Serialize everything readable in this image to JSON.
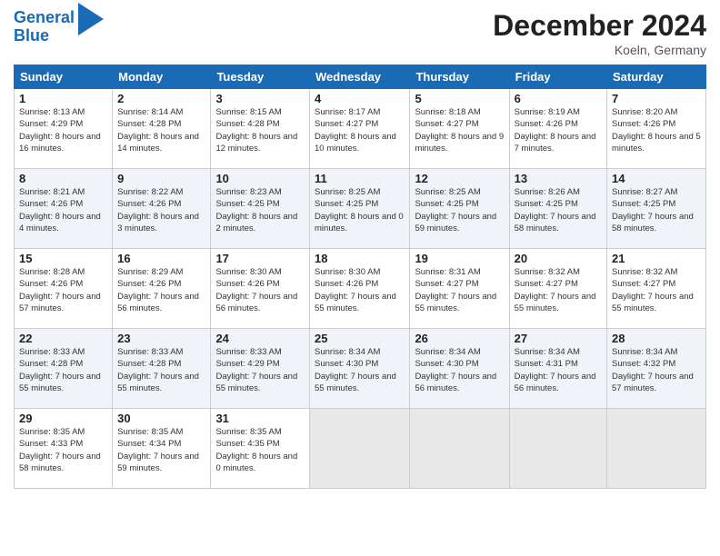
{
  "header": {
    "logo_line1": "General",
    "logo_line2": "Blue",
    "month_title": "December 2024",
    "location": "Koeln, Germany"
  },
  "weekdays": [
    "Sunday",
    "Monday",
    "Tuesday",
    "Wednesday",
    "Thursday",
    "Friday",
    "Saturday"
  ],
  "weeks": [
    [
      {
        "day": "1",
        "sunrise": "8:13 AM",
        "sunset": "4:29 PM",
        "daylight": "8 hours and 16 minutes."
      },
      {
        "day": "2",
        "sunrise": "8:14 AM",
        "sunset": "4:28 PM",
        "daylight": "8 hours and 14 minutes."
      },
      {
        "day": "3",
        "sunrise": "8:15 AM",
        "sunset": "4:28 PM",
        "daylight": "8 hours and 12 minutes."
      },
      {
        "day": "4",
        "sunrise": "8:17 AM",
        "sunset": "4:27 PM",
        "daylight": "8 hours and 10 minutes."
      },
      {
        "day": "5",
        "sunrise": "8:18 AM",
        "sunset": "4:27 PM",
        "daylight": "8 hours and 9 minutes."
      },
      {
        "day": "6",
        "sunrise": "8:19 AM",
        "sunset": "4:26 PM",
        "daylight": "8 hours and 7 minutes."
      },
      {
        "day": "7",
        "sunrise": "8:20 AM",
        "sunset": "4:26 PM",
        "daylight": "8 hours and 5 minutes."
      }
    ],
    [
      {
        "day": "8",
        "sunrise": "8:21 AM",
        "sunset": "4:26 PM",
        "daylight": "8 hours and 4 minutes."
      },
      {
        "day": "9",
        "sunrise": "8:22 AM",
        "sunset": "4:26 PM",
        "daylight": "8 hours and 3 minutes."
      },
      {
        "day": "10",
        "sunrise": "8:23 AM",
        "sunset": "4:25 PM",
        "daylight": "8 hours and 2 minutes."
      },
      {
        "day": "11",
        "sunrise": "8:25 AM",
        "sunset": "4:25 PM",
        "daylight": "8 hours and 0 minutes."
      },
      {
        "day": "12",
        "sunrise": "8:25 AM",
        "sunset": "4:25 PM",
        "daylight": "7 hours and 59 minutes."
      },
      {
        "day": "13",
        "sunrise": "8:26 AM",
        "sunset": "4:25 PM",
        "daylight": "7 hours and 58 minutes."
      },
      {
        "day": "14",
        "sunrise": "8:27 AM",
        "sunset": "4:25 PM",
        "daylight": "7 hours and 58 minutes."
      }
    ],
    [
      {
        "day": "15",
        "sunrise": "8:28 AM",
        "sunset": "4:26 PM",
        "daylight": "7 hours and 57 minutes."
      },
      {
        "day": "16",
        "sunrise": "8:29 AM",
        "sunset": "4:26 PM",
        "daylight": "7 hours and 56 minutes."
      },
      {
        "day": "17",
        "sunrise": "8:30 AM",
        "sunset": "4:26 PM",
        "daylight": "7 hours and 56 minutes."
      },
      {
        "day": "18",
        "sunrise": "8:30 AM",
        "sunset": "4:26 PM",
        "daylight": "7 hours and 55 minutes."
      },
      {
        "day": "19",
        "sunrise": "8:31 AM",
        "sunset": "4:27 PM",
        "daylight": "7 hours and 55 minutes."
      },
      {
        "day": "20",
        "sunrise": "8:32 AM",
        "sunset": "4:27 PM",
        "daylight": "7 hours and 55 minutes."
      },
      {
        "day": "21",
        "sunrise": "8:32 AM",
        "sunset": "4:27 PM",
        "daylight": "7 hours and 55 minutes."
      }
    ],
    [
      {
        "day": "22",
        "sunrise": "8:33 AM",
        "sunset": "4:28 PM",
        "daylight": "7 hours and 55 minutes."
      },
      {
        "day": "23",
        "sunrise": "8:33 AM",
        "sunset": "4:28 PM",
        "daylight": "7 hours and 55 minutes."
      },
      {
        "day": "24",
        "sunrise": "8:33 AM",
        "sunset": "4:29 PM",
        "daylight": "7 hours and 55 minutes."
      },
      {
        "day": "25",
        "sunrise": "8:34 AM",
        "sunset": "4:30 PM",
        "daylight": "7 hours and 55 minutes."
      },
      {
        "day": "26",
        "sunrise": "8:34 AM",
        "sunset": "4:30 PM",
        "daylight": "7 hours and 56 minutes."
      },
      {
        "day": "27",
        "sunrise": "8:34 AM",
        "sunset": "4:31 PM",
        "daylight": "7 hours and 56 minutes."
      },
      {
        "day": "28",
        "sunrise": "8:34 AM",
        "sunset": "4:32 PM",
        "daylight": "7 hours and 57 minutes."
      }
    ],
    [
      {
        "day": "29",
        "sunrise": "8:35 AM",
        "sunset": "4:33 PM",
        "daylight": "7 hours and 58 minutes."
      },
      {
        "day": "30",
        "sunrise": "8:35 AM",
        "sunset": "4:34 PM",
        "daylight": "7 hours and 59 minutes."
      },
      {
        "day": "31",
        "sunrise": "8:35 AM",
        "sunset": "4:35 PM",
        "daylight": "8 hours and 0 minutes."
      },
      null,
      null,
      null,
      null
    ]
  ]
}
